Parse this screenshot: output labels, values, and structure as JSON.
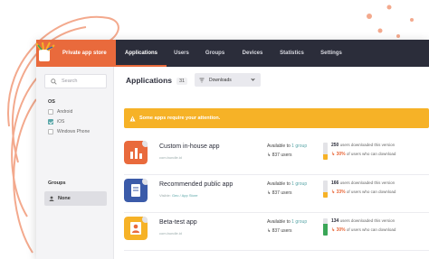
{
  "brand": {
    "label": "Private app store"
  },
  "nav": [
    {
      "label": "Applications",
      "active": true
    },
    {
      "label": "Users"
    },
    {
      "label": "Groups"
    },
    {
      "label": "Devices"
    },
    {
      "label": "Statistics"
    },
    {
      "label": "Settings"
    }
  ],
  "sidebar": {
    "search_placeholder": "Search",
    "os_heading": "OS",
    "os_options": [
      {
        "label": "Android",
        "checked": false
      },
      {
        "label": "iOS",
        "checked": true
      },
      {
        "label": "Windows Phone",
        "checked": false
      }
    ],
    "groups_heading": "Groups",
    "groups_value": "None"
  },
  "main": {
    "title": "Applications",
    "count": "31",
    "filter_value": "Downloads",
    "alert_text": "Some apps require your attention."
  },
  "apps": [
    {
      "name": "Custom in-house app",
      "subtitle": "com.bundle.id",
      "subtitle_link": "",
      "available_prefix": "Available to",
      "available_group": "1 group",
      "users": "837 users",
      "downloads": "250",
      "downloads_text": "users downloaded this version",
      "percent": "30%",
      "percent_text": "of users who can download",
      "fill": 0.3,
      "fill_color": "#f6b227",
      "icon_color": "#e96a3c"
    },
    {
      "name": "Recommended public app",
      "subtitle": "Visible:",
      "subtitle_link": "Geo / App Store",
      "available_prefix": "Available to",
      "available_group": "1 group",
      "users": "837 users",
      "downloads": "166",
      "downloads_text": "users downloaded this version",
      "percent": "33%",
      "percent_text": "of users who can download",
      "fill": 0.33,
      "fill_color": "#f6b227",
      "icon_color": "#3b5ba9"
    },
    {
      "name": "Beta-test app",
      "subtitle": "com.bundle.id",
      "subtitle_link": "",
      "available_prefix": "Available to",
      "available_group": "1 group",
      "users": "837 users",
      "downloads": "134",
      "downloads_text": "users downloaded this version",
      "percent": "30%",
      "percent_text": "of users who can download",
      "fill": 0.7,
      "fill_color": "#3aa657",
      "icon_color": "#f6b227"
    }
  ],
  "colors": {
    "accent": "#e96a3c",
    "nav_bg": "#2b2d3a",
    "alert": "#f6b227",
    "teal": "#5aa6a8"
  }
}
